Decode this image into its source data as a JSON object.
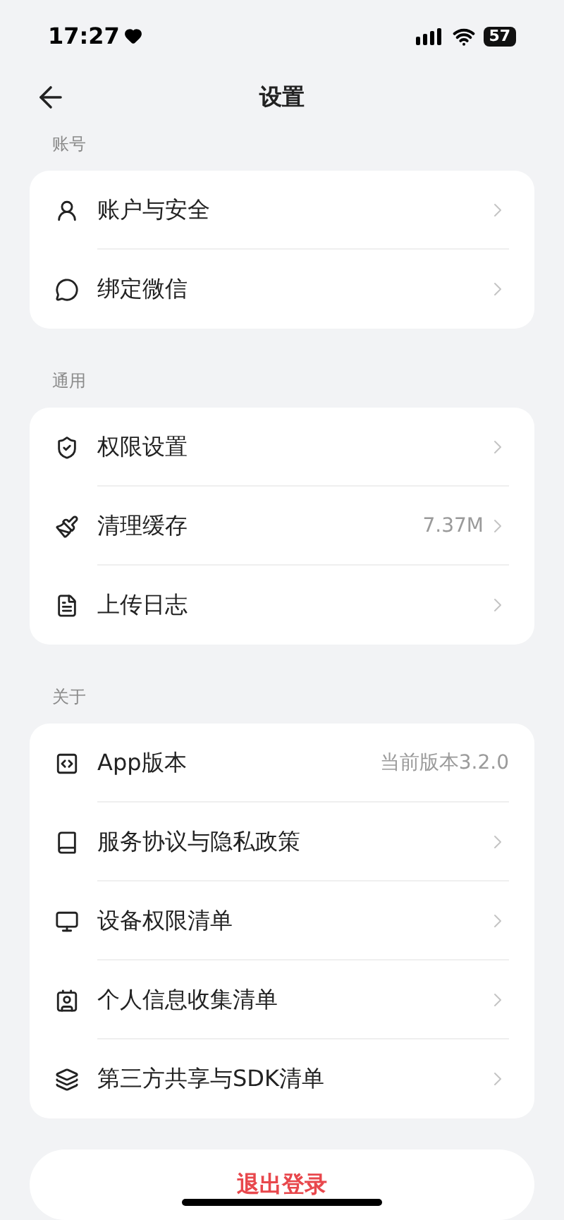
{
  "status_bar": {
    "time": "17:27",
    "battery": "57"
  },
  "header": {
    "title": "设置"
  },
  "sections": [
    {
      "label": "账号",
      "items": [
        {
          "label": "账户与安全",
          "arrow": true
        },
        {
          "label": "绑定微信",
          "arrow": true
        }
      ]
    },
    {
      "label": "通用",
      "items": [
        {
          "label": "权限设置",
          "arrow": true
        },
        {
          "label": "清理缓存",
          "value": "7.37M",
          "arrow": true
        },
        {
          "label": "上传日志",
          "arrow": true
        }
      ]
    },
    {
      "label": "关于",
      "items": [
        {
          "label": "App版本",
          "value": "当前版本3.2.0",
          "arrow": false
        },
        {
          "label": "服务协议与隐私政策",
          "arrow": true
        },
        {
          "label": "设备权限清单",
          "arrow": true
        },
        {
          "label": "个人信息收集清单",
          "arrow": true
        },
        {
          "label": "第三方共享与SDK清单",
          "arrow": true
        }
      ]
    }
  ],
  "logout_button": "退出登录"
}
